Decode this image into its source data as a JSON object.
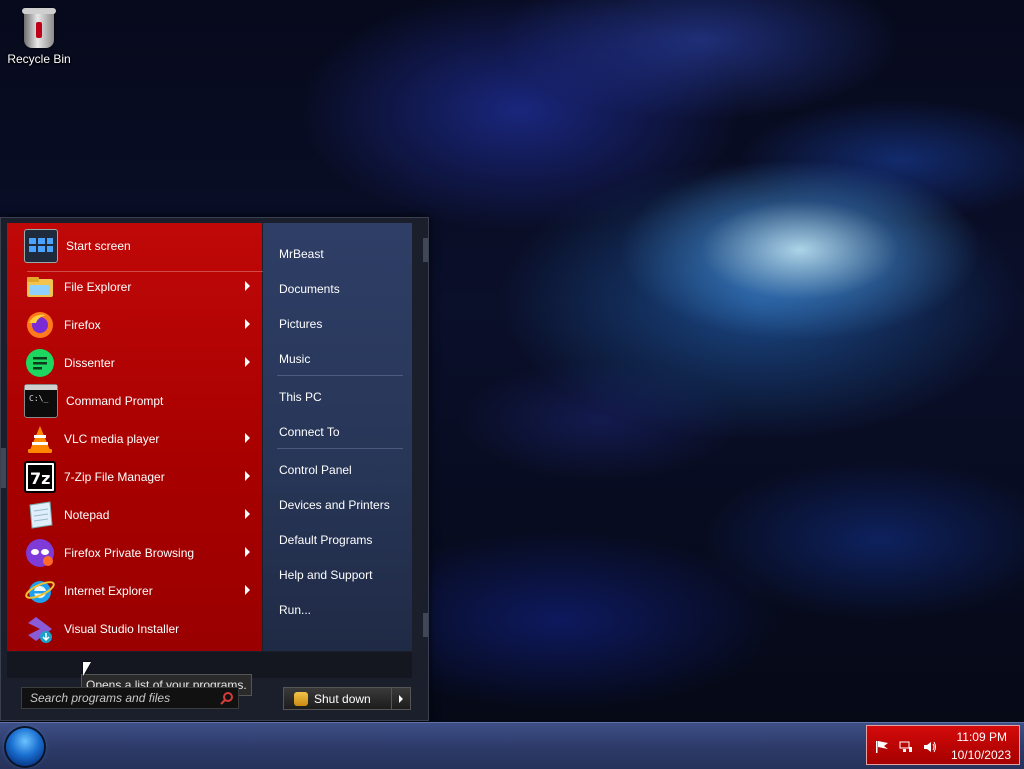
{
  "desktop": {
    "icons": [
      {
        "label": "Recycle Bin",
        "icon": "recycle-bin-icon"
      }
    ]
  },
  "start_menu": {
    "pinned": [
      {
        "label": "Start screen",
        "icon": "start-screen-icon",
        "has_submenu": false
      },
      {
        "label": "File Explorer",
        "icon": "file-explorer-icon",
        "has_submenu": true
      },
      {
        "label": "Firefox",
        "icon": "firefox-icon",
        "has_submenu": true
      },
      {
        "label": "Dissenter",
        "icon": "dissenter-icon",
        "has_submenu": true
      },
      {
        "label": "Command Prompt",
        "icon": "command-prompt-icon",
        "has_submenu": false
      },
      {
        "label": "VLC media player",
        "icon": "vlc-icon",
        "has_submenu": true
      },
      {
        "label": "7-Zip File Manager",
        "icon": "7zip-icon",
        "has_submenu": true
      },
      {
        "label": "Notepad",
        "icon": "notepad-icon",
        "has_submenu": true
      },
      {
        "label": "Firefox Private Browsing",
        "icon": "firefox-private-icon",
        "has_submenu": true
      },
      {
        "label": "Internet Explorer",
        "icon": "internet-explorer-icon",
        "has_submenu": true
      },
      {
        "label": "Visual Studio Installer",
        "icon": "visual-studio-installer-icon",
        "has_submenu": false
      }
    ],
    "right_links": [
      "MrBeast",
      "Documents",
      "Pictures",
      "Music",
      "This PC",
      "Connect To",
      "Control Panel",
      "Devices and Printers",
      "Default Programs",
      "Help and Support",
      "Run..."
    ],
    "all_programs_tooltip": "Opens a list of your programs.",
    "search_placeholder": "Search programs and files",
    "shutdown_label": "Shut down"
  },
  "taskbar": {
    "time": "11:09 PM",
    "date": "10/10/2023",
    "tray_icons": [
      "action-center-flag-icon",
      "network-icon",
      "volume-icon"
    ]
  },
  "colors": {
    "left_pane": "#b00000",
    "right_pane": "#2a3860",
    "taskbar": "#2e3c6a",
    "tray": "#c40404"
  }
}
